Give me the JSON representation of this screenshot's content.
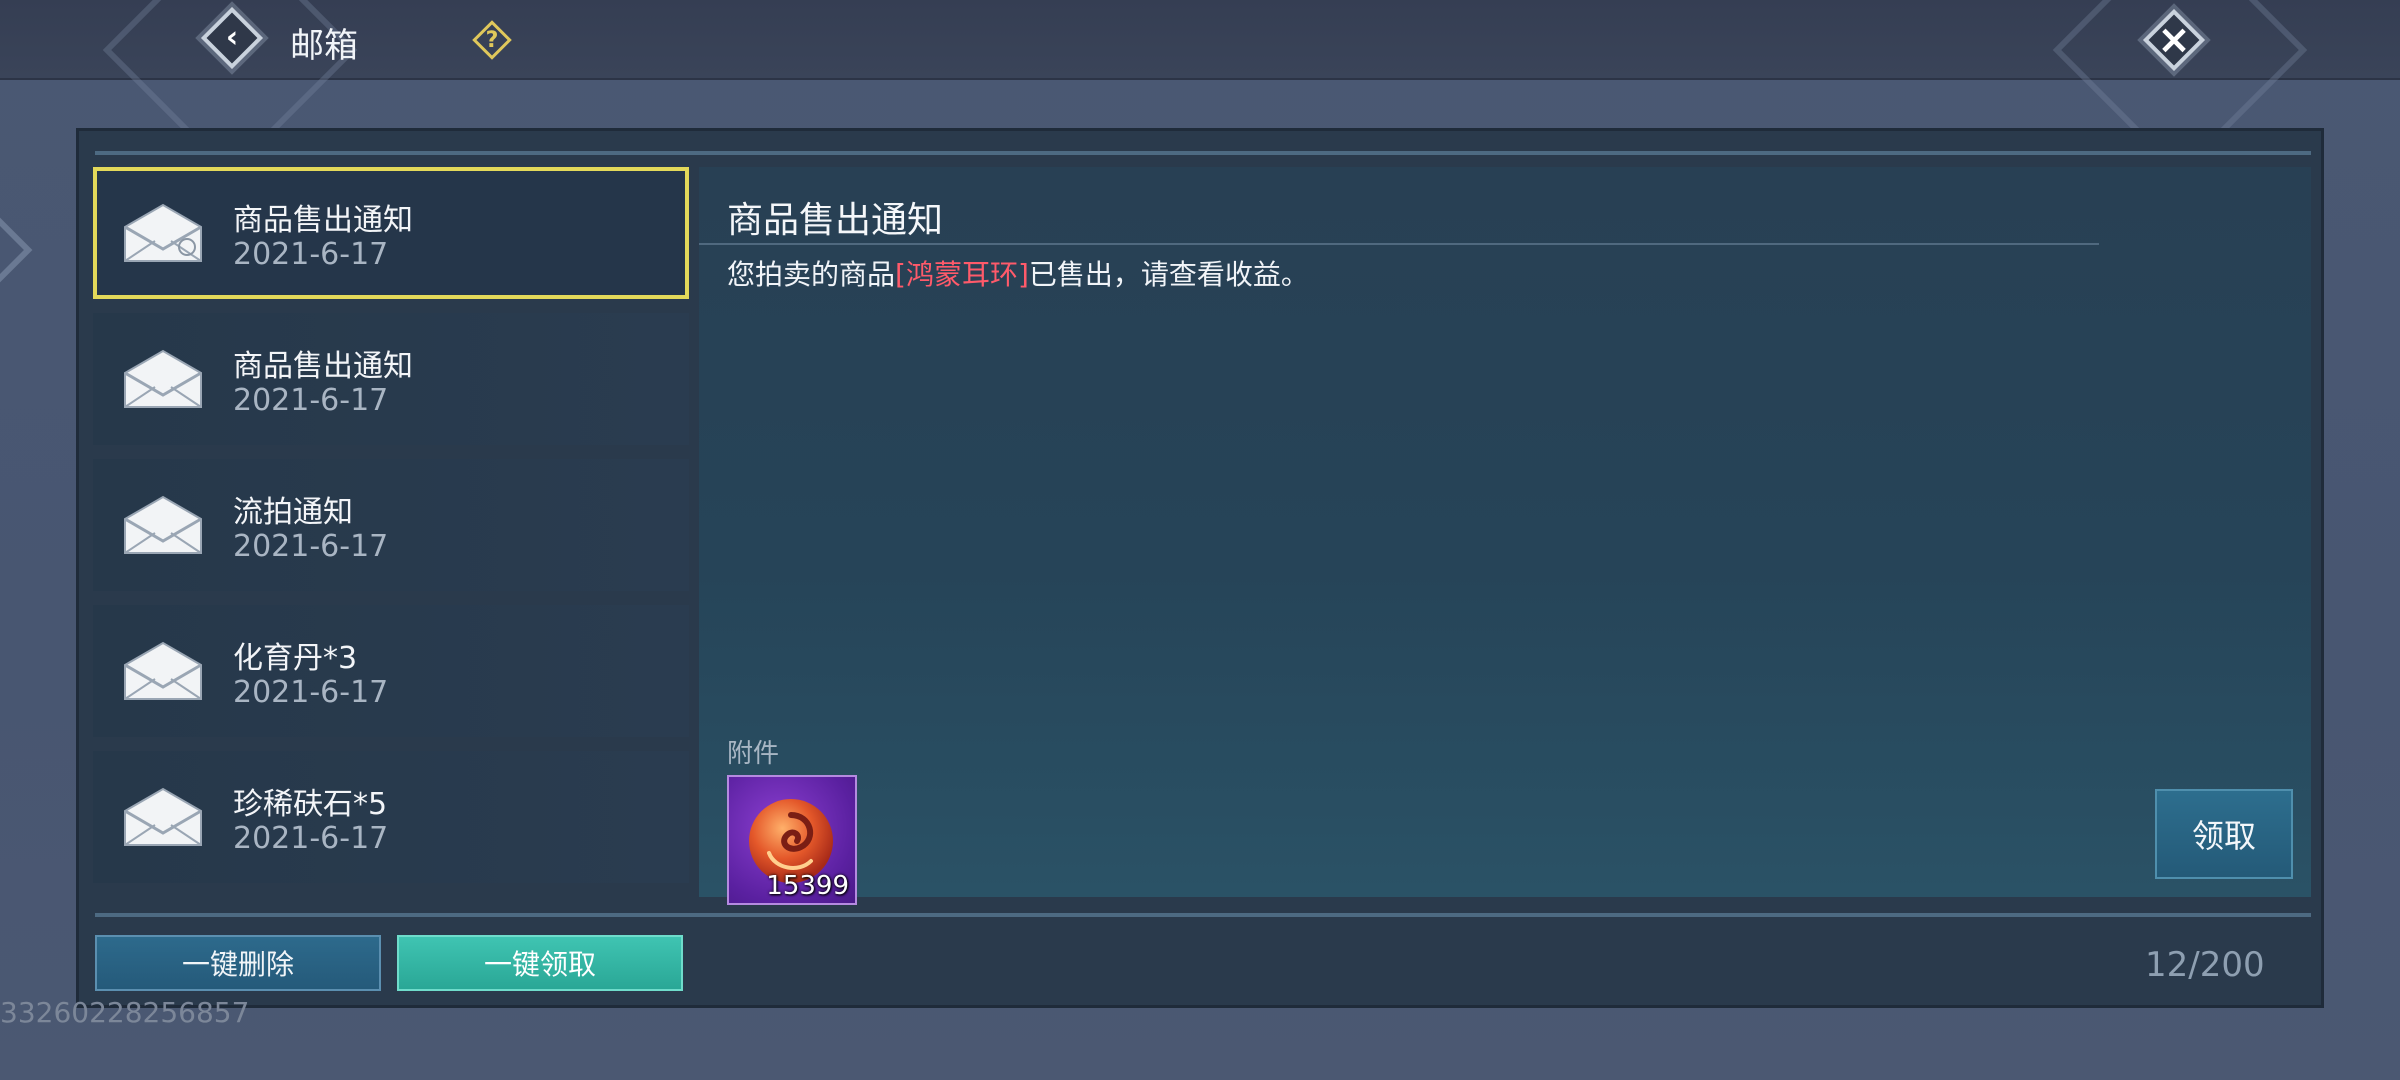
{
  "header": {
    "title": "邮箱"
  },
  "mail_list": {
    "items": [
      {
        "title": "商品售出通知",
        "date": "2021-6-17",
        "selected": true
      },
      {
        "title": "商品售出通知",
        "date": "2021-6-17",
        "selected": false
      },
      {
        "title": "流拍通知",
        "date": "2021-6-17",
        "selected": false
      },
      {
        "title": "化育丹*3",
        "date": "2021-6-17",
        "selected": false
      },
      {
        "title": "珍稀砆石*5",
        "date": "2021-6-17",
        "selected": false
      }
    ]
  },
  "detail": {
    "title": "商品售出通知",
    "body_prefix": "您拍卖的商品",
    "body_item": "[鸿蒙耳环]",
    "body_suffix": "已售出，请查看收益。",
    "attachment_label": "附件",
    "attachment_count": "15399",
    "claim_label": "领取"
  },
  "footer": {
    "delete_all_label": "一键删除",
    "claim_all_label": "一键领取",
    "mail_count": "12/200"
  },
  "uid": "33260228256857",
  "colors": {
    "selected_outline": "#e3d95a",
    "highlight_text": "#ff5a6a",
    "claim_all_button": "#3fc4b2",
    "attachment_bg": "#7a30c0"
  },
  "icons": {
    "back": "back-arrow-icon",
    "help": "question-icon",
    "close": "close-icon",
    "mail": "envelope-icon",
    "attachment": "swirl-orb-icon"
  }
}
